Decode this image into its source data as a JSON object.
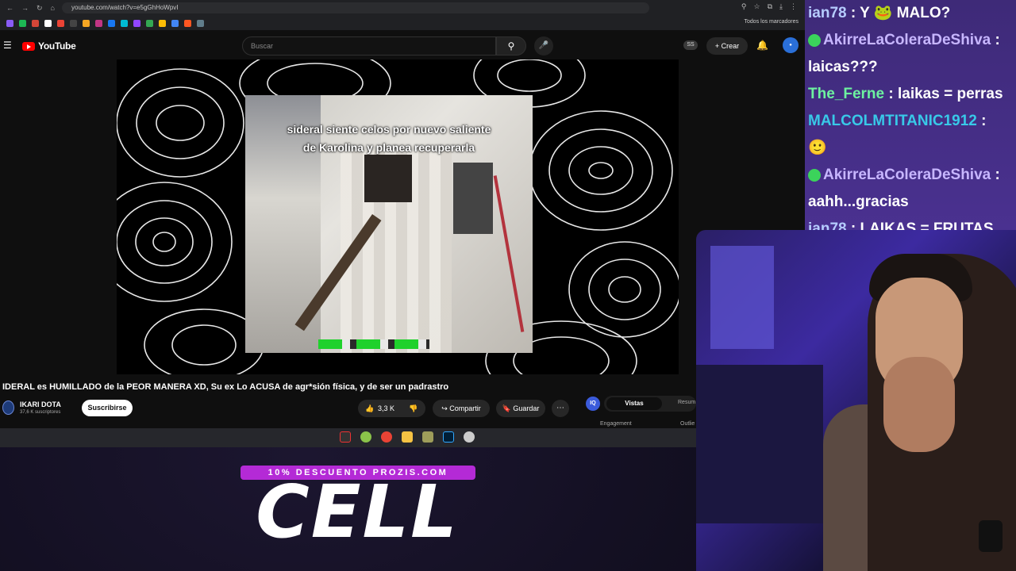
{
  "browser": {
    "url": "youtube.com/watch?v=e5gGhHoWpvI",
    "bookmarks_label": "Todos los marcadores"
  },
  "youtube": {
    "logo": "YouTube",
    "search_placeholder": "Buscar",
    "ss_badge": "SS",
    "create_label": "Crear",
    "video_caption_line1": "sideral siente celos por nuevo saliente",
    "video_caption_line2": "de Karolina y planea recuperarla",
    "title": "IDERAL es HUMILLADO de la PEOR MANERA XD, Su ex Lo ACUSA de agr*sión física, y de ser un padrastro",
    "channel": {
      "name": "IKARI DOTA",
      "subscribers": "37,6 K suscriptores"
    },
    "subscribe_label": "Suscribirse",
    "likes": "3,3 K",
    "share_label": "Compartir",
    "save_label": "Guardar",
    "extension": {
      "icon_text": "IQ",
      "tab_active": "Vistas",
      "tab_other": "Resum",
      "metric_1": "Engagement",
      "metric_2": "Outlie"
    }
  },
  "overlay": {
    "promo_text": "10% DESCUENTO PROZIS.COM",
    "brand_text": "CELL"
  },
  "chat": {
    "messages": [
      {
        "user": "ian78",
        "text": "Y 🐸 MALO?"
      },
      {
        "user": "AkirreLaColeraDeShiva",
        "text": "laicas???"
      },
      {
        "user": "The_Ferne",
        "text": "laikas = perras"
      },
      {
        "user": "MALCOLMTITANIC1912",
        "text": ""
      },
      {
        "user": "AkirreLaColeraDeShiva",
        "text": "aahh...gracias"
      },
      {
        "user": "ian78",
        "text": "LAIKAS = FRUTAS"
      }
    ]
  },
  "colors": {
    "yt_red": "#ff0000",
    "promo": "#b42ad6",
    "chat_bg": "#3e2a78"
  }
}
